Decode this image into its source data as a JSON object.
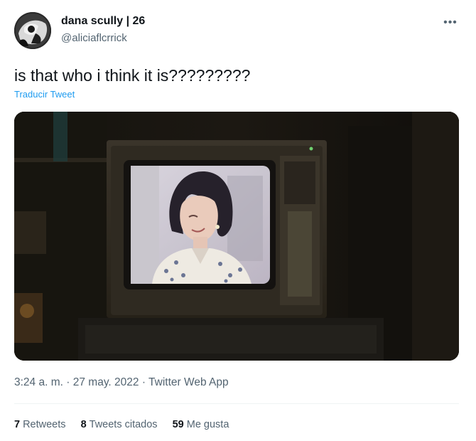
{
  "tweet": {
    "author": {
      "display_name": "dana scully | 26",
      "handle": "@aliciaflcrrick",
      "avatar_icon": "avatar-photo"
    },
    "more_icon": "more-options-icon",
    "text": "is that who i think it is?????????",
    "translate_label": "Traducir Tweet",
    "media": {
      "kind": "photo",
      "description_icon": "tv-still-image"
    },
    "meta": {
      "time": "3:24 a. m.",
      "separator": "·",
      "date": "27 may. 2022",
      "source": "Twitter Web App"
    },
    "stats": [
      {
        "count": "7",
        "label": "Retweets"
      },
      {
        "count": "8",
        "label": "Tweets citados"
      },
      {
        "count": "59",
        "label": "Me gusta"
      }
    ]
  },
  "colors": {
    "text_primary": "#0f1419",
    "text_secondary": "#536471",
    "link": "#1d9bf0",
    "divider": "#eff3f4"
  }
}
